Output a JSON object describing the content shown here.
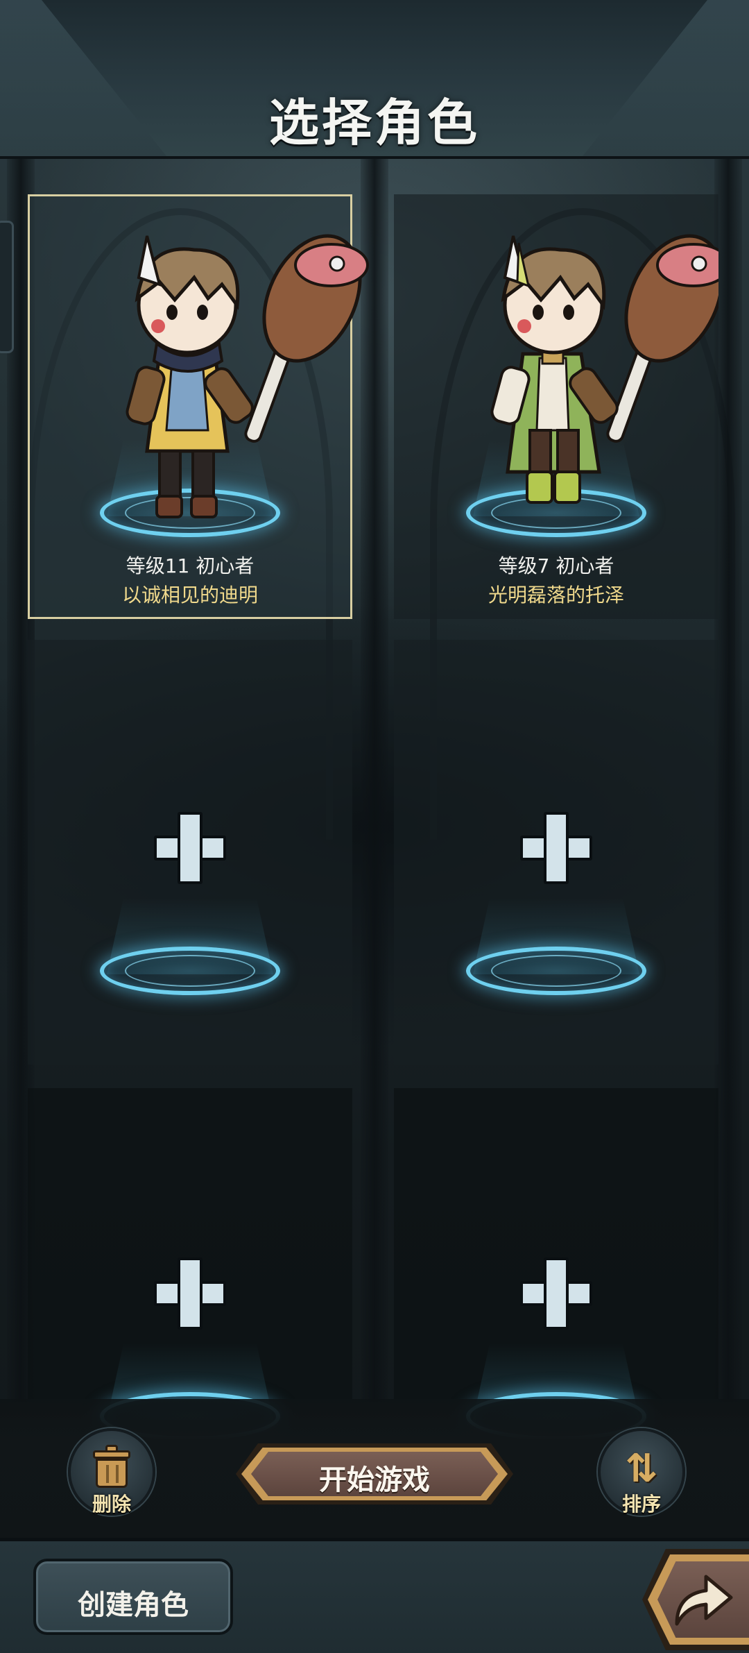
{
  "header": {
    "title": "选择角色"
  },
  "slots": [
    {
      "state": "character",
      "selected": true,
      "level_class": "等级11  初心者",
      "name": "以诚相见的迪明",
      "outfit_color": "#e5c35a"
    },
    {
      "state": "character",
      "selected": false,
      "level_class": "等级7  初心者",
      "name": "光明磊落的托泽",
      "outfit_color": "#8fb35a"
    },
    {
      "state": "empty",
      "icon": "plus-icon"
    },
    {
      "state": "empty",
      "icon": "plus-icon"
    },
    {
      "state": "empty",
      "icon": "plus-icon"
    },
    {
      "state": "empty",
      "icon": "plus-icon"
    }
  ],
  "controls": {
    "delete_label": "删除",
    "delete_icon": "trash-icon",
    "start_label": "开始游戏",
    "sort_label": "排序",
    "sort_icon": "sort-arrows-icon"
  },
  "bottom_bar": {
    "create_label": "创建角色",
    "forward_icon": "forward-arrow-icon"
  },
  "colors": {
    "name_gold": "#f0d98c",
    "selection_border": "#d8cfa2",
    "platform_glow": "#6fd0ef",
    "button_gold": "#c79a58"
  }
}
